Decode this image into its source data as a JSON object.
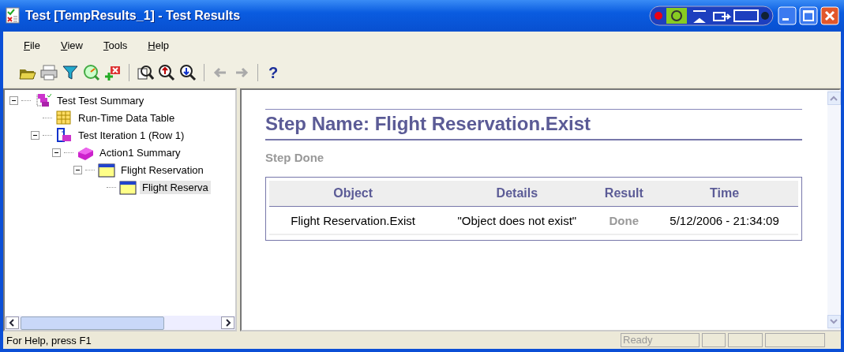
{
  "window": {
    "title": "Test [TempResults_1] - Test Results"
  },
  "menu": [
    "File",
    "View",
    "Tools",
    "Help"
  ],
  "toolbar": {
    "navigation": [
      {
        "disabled": true
      },
      {
        "disabled": true
      }
    ],
    "help_label": "?"
  },
  "tree": [
    {
      "label": "Test Test Summary",
      "kind": "summary",
      "expanded": true,
      "selected": false,
      "children": [
        {
          "label": "Run-Time Data Table",
          "kind": "data-table",
          "selected": false
        },
        {
          "label": "Test Iteration 1 (Row 1)",
          "kind": "iteration",
          "expanded": true,
          "selected": false,
          "children": [
            {
              "label": "Action1 Summary",
              "kind": "action",
              "expanded": true,
              "selected": false,
              "children": [
                {
                  "label": "Flight Reservation",
                  "kind": "step",
                  "expanded": true,
                  "selected": false,
                  "children": [
                    {
                      "label": "Flight Reserva",
                      "kind": "step",
                      "selected": true
                    }
                  ]
                }
              ]
            }
          ]
        }
      ]
    }
  ],
  "report": {
    "title": "Step Name: Flight Reservation.Exist",
    "status": "Step Done",
    "table": {
      "columns": [
        "Object",
        "Details",
        "Result",
        "Time"
      ],
      "rows": [
        [
          "Flight Reservation.Exist",
          "\"Object does not exist\"",
          "Done",
          "5/12/2006 - 21:34:09"
        ]
      ]
    }
  },
  "status_bar": {
    "message": "For Help, press F1",
    "panes": [
      "Ready"
    ]
  }
}
